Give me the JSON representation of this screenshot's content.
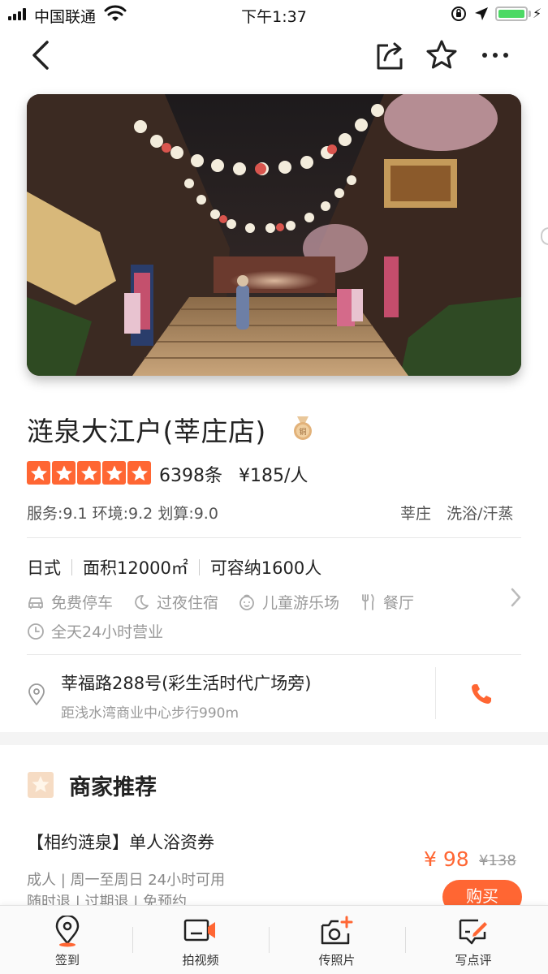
{
  "status_bar": {
    "carrier": "中国联通",
    "time": "下午1:37"
  },
  "nav": {
    "back_icon": "chevron-left-icon",
    "share_icon": "share-icon",
    "favorite_icon": "star-outline-icon",
    "more_icon": "more-dots-icon"
  },
  "shop": {
    "name": "涟泉大江户(莘庄店)",
    "medal_text": "铜",
    "rating_stars": 5,
    "review_count": "6398条",
    "avg_price": "¥185/人",
    "scores": "服务:9.1 环境:9.2 划算:9.0",
    "area": "莘庄",
    "category": "洗浴/汗蒸"
  },
  "facility": {
    "style": "日式",
    "size": "面积12000㎡",
    "capacity": "可容纳1600人",
    "amenities": [
      {
        "label": "免费停车",
        "icon": "car-icon"
      },
      {
        "label": "过夜住宿",
        "icon": "moon-icon"
      },
      {
        "label": "儿童游乐场",
        "icon": "child-face-icon"
      },
      {
        "label": "餐厅",
        "icon": "fork-knife-icon"
      }
    ],
    "hours": "全天24小时营业"
  },
  "address": {
    "street": "莘福路288号(彩生活时代广场旁)",
    "distance": "距浅水湾商业中心步行990m"
  },
  "recommend": {
    "title": "商家推荐",
    "deal": {
      "name": "【相约涟泉】单人浴资券",
      "price": "¥ 98",
      "original_price": "¥138",
      "meta": "成人 | 周一至周日 24小时可用",
      "meta2": "随时退 | 过期退 | 免预约",
      "buy_label": "购买"
    }
  },
  "tabs": [
    {
      "label": "签到",
      "icon": "location-pin-icon"
    },
    {
      "label": "拍视频",
      "icon": "video-camera-icon"
    },
    {
      "label": "传照片",
      "icon": "camera-add-icon"
    },
    {
      "label": "写点评",
      "icon": "write-review-icon"
    }
  ],
  "colors": {
    "accent": "#ff6633",
    "text_primary": "#222222",
    "text_secondary": "#999999"
  }
}
